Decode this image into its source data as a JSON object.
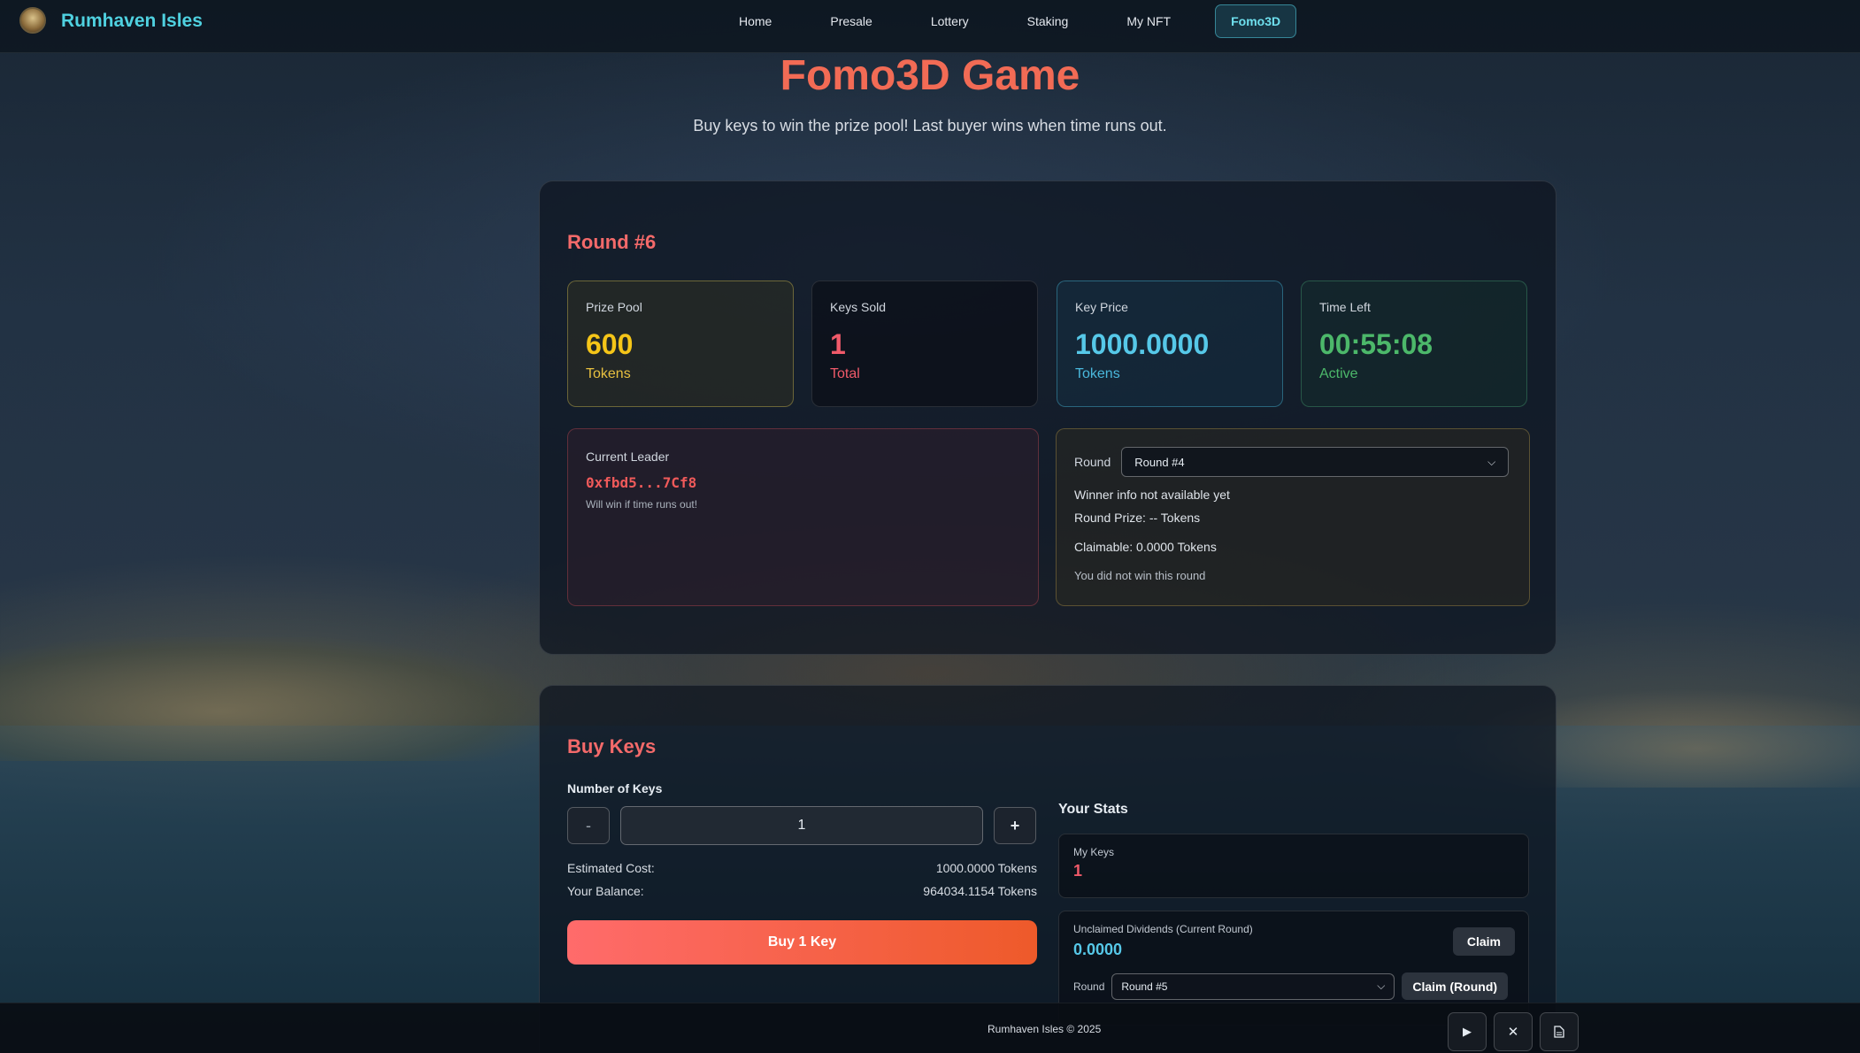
{
  "nav": {
    "brand": "Rumhaven Isles",
    "links": [
      "Home",
      "Presale",
      "Lottery",
      "Staking",
      "My NFT"
    ],
    "active": "Fomo3D"
  },
  "header": {
    "title": "Fomo3D Game",
    "subtitle": "Buy keys to win the prize pool! Last buyer wins when time runs out."
  },
  "round": {
    "title": "Round #6",
    "stats": {
      "prize_pool": {
        "label": "Prize Pool",
        "value": "600",
        "sub": "Tokens"
      },
      "keys_sold": {
        "label": "Keys Sold",
        "value": "1",
        "sub": "Total"
      },
      "key_price": {
        "label": "Key Price",
        "value": "1000.0000",
        "sub": "Tokens"
      },
      "time_left": {
        "label": "Time Left",
        "value": "00:55:08",
        "sub": "Active"
      }
    },
    "leader": {
      "label": "Current Leader",
      "address": "0xfbd5...7Cf8",
      "note": "Will win if time runs out!"
    },
    "winner": {
      "round_label": "Round",
      "selected_round": "Round #4",
      "info": "Winner info not available yet",
      "round_prize": "Round Prize: -- Tokens",
      "claimable": "Claimable: 0.0000 Tokens",
      "status": "You did not win this round"
    }
  },
  "buy": {
    "title": "Buy Keys",
    "field_label": "Number of Keys",
    "minus": "-",
    "plus": "+",
    "quantity": "1",
    "estimated_cost_label": "Estimated Cost:",
    "estimated_cost": "1000.0000 Tokens",
    "balance_label": "Your Balance:",
    "balance": "964034.1154 Tokens",
    "button": "Buy 1 Key"
  },
  "stats": {
    "title": "Your Stats",
    "my_keys_label": "My Keys",
    "my_keys": "1",
    "dividends_label": "Unclaimed Dividends (Current Round)",
    "dividends": "0.0000",
    "claim": "Claim",
    "round_label": "Round",
    "selected_round": "Round #5",
    "claim_round": "Claim (Round)"
  },
  "footer": {
    "copyright": "Rumhaven Isles © 2025",
    "icons": [
      "play-icon",
      "x-icon",
      "document-icon"
    ]
  }
}
